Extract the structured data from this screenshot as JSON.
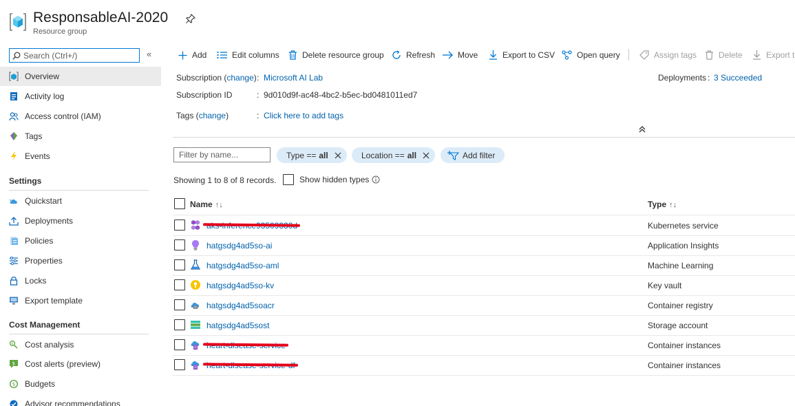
{
  "header": {
    "title": "ResponsableAI-2020",
    "subtitle": "Resource group"
  },
  "sidebar": {
    "search_placeholder": "Search (Ctrl+/)",
    "collapse_glyph": "«",
    "items": [
      {
        "label": "Overview",
        "icon": "overview-icon",
        "active": true
      },
      {
        "label": "Activity log",
        "icon": "activity-log-icon"
      },
      {
        "label": "Access control (IAM)",
        "icon": "people-icon"
      },
      {
        "label": "Tags",
        "icon": "tag-icon"
      },
      {
        "label": "Events",
        "icon": "lightning-icon"
      }
    ],
    "settings_title": "Settings",
    "settings_items": [
      {
        "label": "Quickstart",
        "icon": "cloud-icon"
      },
      {
        "label": "Deployments",
        "icon": "upload-icon"
      },
      {
        "label": "Policies",
        "icon": "policy-icon"
      },
      {
        "label": "Properties",
        "icon": "sliders-icon"
      },
      {
        "label": "Locks",
        "icon": "lock-icon"
      },
      {
        "label": "Export template",
        "icon": "monitor-icon"
      }
    ],
    "cost_title": "Cost Management",
    "cost_items": [
      {
        "label": "Cost analysis",
        "icon": "cost-analysis-icon"
      },
      {
        "label": "Cost alerts (preview)",
        "icon": "cost-alert-icon"
      },
      {
        "label": "Budgets",
        "icon": "budget-icon"
      },
      {
        "label": "Advisor recommendations",
        "icon": "advisor-icon"
      }
    ]
  },
  "toolbar": {
    "add": "Add",
    "edit_columns": "Edit columns",
    "delete_rg": "Delete resource group",
    "refresh": "Refresh",
    "move": "Move",
    "export_csv": "Export to CSV",
    "open_query": "Open query",
    "assign_tags": "Assign tags",
    "delete": "Delete",
    "export_t": "Export t"
  },
  "essentials": {
    "subscription_label": "Subscription (",
    "change": "change",
    "subscription_label_end": ")",
    "subscription_value": "Microsoft AI Lab",
    "subscription_id_label": "Subscription ID",
    "subscription_id_value": "9d010d9f-ac48-4bc2-b5ec-bd0481011ed7",
    "tags_label": "Tags (",
    "tags_label_end": ")",
    "tags_value": "Click here to add tags",
    "deployments_label": "Deployments",
    "deployments_value": "3 Succeeded",
    "colon": ":"
  },
  "filters": {
    "name_placeholder": "Filter by name...",
    "type_label": "Type ==",
    "type_value": "all",
    "location_label": "Location ==",
    "location_value": "all",
    "add_filter": "Add filter"
  },
  "records": {
    "showing": "Showing 1 to 8 of 8 records.",
    "show_hidden": "Show hidden types"
  },
  "table": {
    "col_name": "Name",
    "col_name_sort": "↑↓",
    "col_type": "Type",
    "col_type_sort": "↑↓",
    "rows": [
      {
        "name": "aks-inference93509330d",
        "type": "Kubernetes service",
        "icon": "kubernetes-icon",
        "redacted": true,
        "redact_width": 391
      },
      {
        "name": "hatgsdg4ad5so-ai",
        "type": "Application Insights",
        "icon": "app-insights-icon"
      },
      {
        "name": "hatgsdg4ad5so-aml",
        "type": "Machine Learning",
        "icon": "machine-learning-icon"
      },
      {
        "name": "hatgsdg4ad5so-kv",
        "type": "Key vault",
        "icon": "key-vault-icon"
      },
      {
        "name": "hatgsdg4ad5soacr",
        "type": "Container registry",
        "icon": "container-registry-icon"
      },
      {
        "name": "hatgsdg4ad5sost",
        "type": "Storage account",
        "icon": "storage-account-icon"
      },
      {
        "name": "heart-disease-service",
        "type": "Container instances",
        "icon": "container-instance-icon",
        "redacted": true,
        "redact_width": 374
      },
      {
        "name": "heart-disease-service-df",
        "type": "Container instances",
        "icon": "container-instance-icon",
        "redacted": true,
        "redact_width": 388
      }
    ]
  },
  "colors": {
    "accent": "#0078d4",
    "link": "#0062ad",
    "pill": "#dcebf8",
    "active_nav": "#ebebeb",
    "redaction": "#e3001b"
  }
}
